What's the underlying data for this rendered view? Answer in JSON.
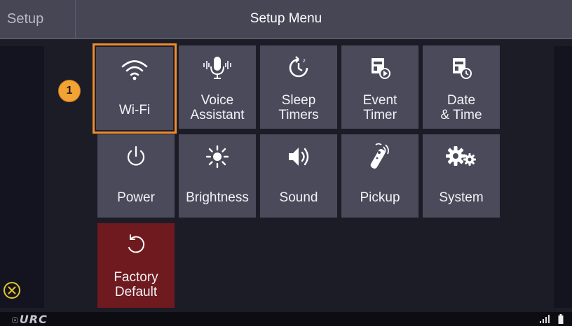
{
  "header": {
    "back_label": "Setup",
    "title": "Setup Menu"
  },
  "callout": {
    "number": "1"
  },
  "tiles": [
    {
      "label": "Wi-Fi",
      "icon": "wifi-icon",
      "selected": true
    },
    {
      "label": "Voice\nAssistant",
      "icon": "microphone-icon"
    },
    {
      "label": "Sleep\nTimers",
      "icon": "sleep-timer-icon"
    },
    {
      "label": "Event\nTimer",
      "icon": "event-timer-icon"
    },
    {
      "label": "Date\n& Time",
      "icon": "date-time-icon"
    },
    {
      "label": "Power",
      "icon": "power-icon"
    },
    {
      "label": "Brightness",
      "icon": "brightness-icon"
    },
    {
      "label": "Sound",
      "icon": "speaker-icon"
    },
    {
      "label": "Pickup",
      "icon": "remote-pickup-icon"
    },
    {
      "label": "System",
      "icon": "gears-icon"
    },
    {
      "label": "Factory\nDefault",
      "icon": "reset-icon"
    }
  ],
  "footer": {
    "logo_text": "URC"
  },
  "colors": {
    "selected_outline": "#f08b2c",
    "badge": "#f3a333",
    "factory_default_tile": "#6e1a1f",
    "close_icon": "#e6c32b"
  }
}
